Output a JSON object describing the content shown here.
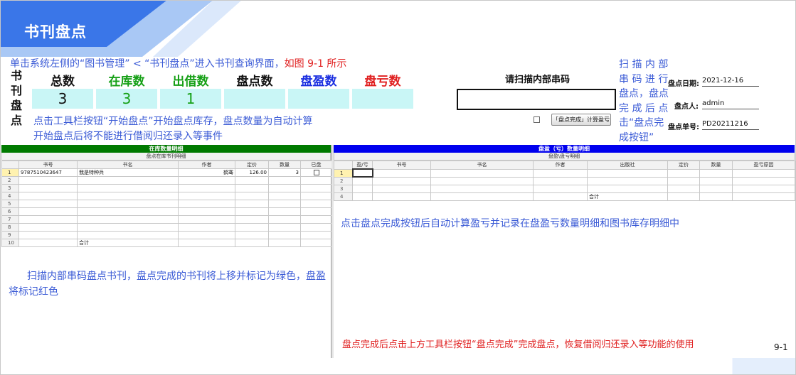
{
  "banner": {
    "title": "书刊盘点"
  },
  "instructions": {
    "line1": "单击系统左侧的“图书管理” < “书刊盘点”进入书刊查询界面，",
    "line1_red": "如图 9-1 所示",
    "start_hint_1": "点击工具栏按钮“开始盘点”开始盘点库存，盘点数量为自动计算",
    "start_hint_2": "开始盘点后将不能进行借阅归还录入等事件",
    "right_hint": [
      "扫 描 内 部",
      "串 码 进 行",
      "盘点，盘点",
      "完 成 后 点",
      "击“盘点完",
      "成按钮”"
    ],
    "scan_hint": "扫描内部串码盘点书刊，盘点完成的书刊将上移并标记为绿色，盘盈将标记红色",
    "auto_calc_hint": "点击盘点完成按钮后自动计算盈亏并记录在盘盈亏数量明细和图书库存明细中",
    "finish_hint": "盘点完成后点击上方工具栏按钮“盘点完成”完成盘点，恢复借阅归还录入等功能的使用"
  },
  "stats": {
    "side_title": "书刊盘点",
    "headers": [
      {
        "label": "总数",
        "color": "#111111"
      },
      {
        "label": "在库数",
        "color": "#16a016"
      },
      {
        "label": "出借数",
        "color": "#16a016"
      },
      {
        "label": "盘点数",
        "color": "#111111"
      },
      {
        "label": "盘盈数",
        "color": "#1a2ee0"
      },
      {
        "label": "盘亏数",
        "color": "#e02020"
      }
    ],
    "values": [
      "3",
      "3",
      "1",
      "",
      "",
      ""
    ],
    "value_colors": [
      "#111111",
      "#16a016",
      "#16a016",
      "#111111",
      "#111111",
      "#111111"
    ]
  },
  "scan": {
    "label": "请扫描内部串码",
    "input_value": "",
    "finish_button": "「盘点完成」计算盈亏"
  },
  "info": {
    "date_label": "盘点日期:",
    "date_value": "2021-12-16",
    "person_label": "盘点人:",
    "person_value": "admin",
    "no_label": "盘点单号:",
    "no_value": "PD20211216"
  },
  "left_table": {
    "title": "在库数量明细",
    "subtitle": "盘点在库书刊明细",
    "columns": [
      "书号",
      "书名",
      "作者",
      "定价",
      "数量",
      "已盘"
    ],
    "rows": [
      [
        "9787510423647",
        "我是特种兵",
        "鹤骞",
        "126.00",
        "3",
        "checkbox"
      ],
      [
        "",
        "",
        "",
        "",
        "",
        ""
      ],
      [
        "",
        "",
        "",
        "",
        "",
        ""
      ],
      [
        "",
        "",
        "",
        "",
        "",
        ""
      ],
      [
        "",
        "",
        "",
        "",
        "",
        ""
      ],
      [
        "",
        "",
        "",
        "",
        "",
        ""
      ],
      [
        "",
        "",
        "",
        "",
        "",
        ""
      ],
      [
        "",
        "",
        "",
        "",
        "",
        ""
      ],
      [
        "",
        "",
        "",
        "",
        "",
        ""
      ],
      [
        "",
        "合计",
        "",
        "",
        "",
        ""
      ]
    ]
  },
  "right_table": {
    "title": "盘盈（亏）数量明细",
    "subtitle": "盘盈\\盘亏明细",
    "columns": [
      "盈/亏",
      "书号",
      "书名",
      "作者",
      "出版社",
      "定价",
      "数量",
      "盈亏原因"
    ],
    "rows": [
      [
        "",
        "",
        "",
        "",
        "",
        "",
        "",
        ""
      ],
      [
        "",
        "",
        "",
        "",
        "",
        "",
        "",
        ""
      ],
      [
        "",
        "",
        "",
        "",
        "",
        "",
        "",
        ""
      ],
      [
        "",
        "",
        "",
        "",
        "合计",
        "",
        "",
        ""
      ]
    ]
  },
  "page_number": "9-1",
  "colors": {
    "banner_dark": "#3a76e8",
    "banner_light": "#a9c8f5",
    "instruction_blue": "#3b5bd6",
    "accent_red": "#e02020"
  }
}
